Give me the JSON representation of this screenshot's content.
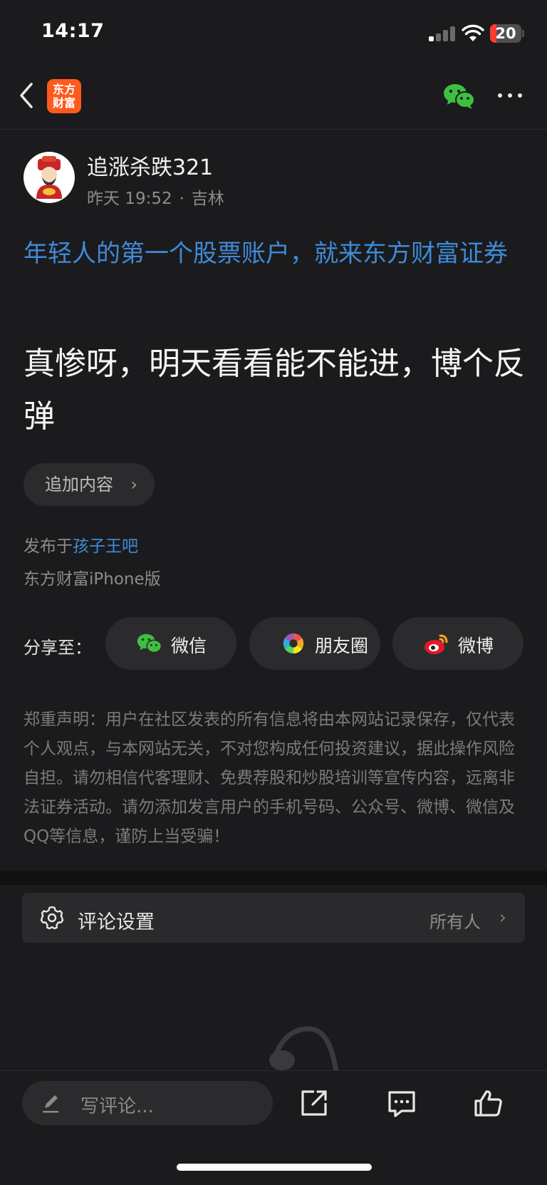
{
  "status_bar": {
    "time": "14:17",
    "battery": "20",
    "battery_level": 0.2
  },
  "nav": {
    "app_logo_text": [
      "东方",
      "财富"
    ],
    "wechat_icon": "wechat-icon",
    "more_icon": "more-dots-icon"
  },
  "author": {
    "name": "追涨杀跌321",
    "time": "昨天 19:52",
    "dot": "·",
    "location": "吉林"
  },
  "promo_text": "年轻人的第一个股票账户，就来东方财富证券",
  "post_text": "真惨呀，明天看看能不能进，博个反弹",
  "append_button": {
    "label": "追加内容",
    "chevron": "›"
  },
  "posted_in": {
    "prefix": "发布于",
    "bar": "孩子王吧"
  },
  "device": "东方财富iPhone版",
  "share": {
    "label": "分享至：",
    "buttons": [
      {
        "label": "微信",
        "icon": "wechat-icon"
      },
      {
        "label": "朋友圈",
        "icon": "moments-icon"
      },
      {
        "label": "微博",
        "icon": "weibo-icon"
      }
    ]
  },
  "disclaimer": "郑重声明：用户在社区发表的所有信息将由本网站记录保存，仅代表个人观点，与本网站无关，不对您构成任何投资建议，据此操作风险自担。请勿相信代客理财、免费荐股和炒股培训等宣传内容，远离非法证券活动。请勿添加发言用户的手机号码、公众号、微博、微信及QQ等信息，谨防上当受骗！",
  "comment_settings": {
    "title": "评论设置",
    "value": "所有人",
    "chevron": "›"
  },
  "bottom_bar": {
    "placeholder": "写评论...",
    "icons": [
      "share-out-icon",
      "comment-icon",
      "like-icon"
    ]
  },
  "colors": {
    "accent_blue": "#3f8ad8",
    "background": "#1b1b1d",
    "wechat_green": "#3fbf3f",
    "logo_orange": "#ff5a1e"
  }
}
